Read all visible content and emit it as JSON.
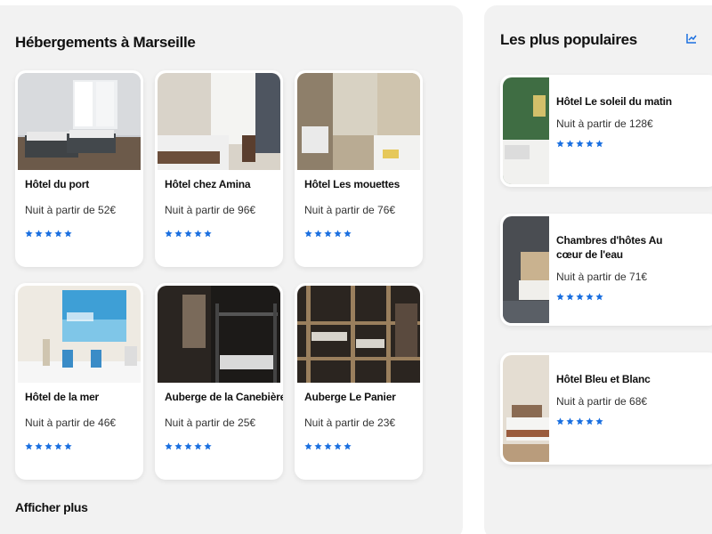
{
  "main": {
    "title": "Hébergements à Marseille",
    "show_more": "Afficher plus",
    "hotels": [
      {
        "name": "Hôtel du port",
        "price": "Nuit à partir de 52€",
        "rating": 5
      },
      {
        "name": "Hôtel chez Amina",
        "price": "Nuit à partir de 96€",
        "rating": 5
      },
      {
        "name": "Hôtel Les mouettes",
        "price": "Nuit à partir de 76€",
        "rating": 5
      },
      {
        "name": "Hôtel de la mer",
        "price": "Nuit à partir de 46€",
        "rating": 5
      },
      {
        "name": "Auberge de la Canebière",
        "price": "Nuit à partir de 25€",
        "rating": 5
      },
      {
        "name": "Auberge Le Panier",
        "price": "Nuit à partir de 23€",
        "rating": 5
      }
    ]
  },
  "sidebar": {
    "title": "Les plus populaires",
    "icon": "chart-icon",
    "items": [
      {
        "name": "Hôtel Le soleil du matin",
        "price": "Nuit à partir de 128€",
        "rating": 5
      },
      {
        "name": "Chambres d'hôtes Au cœur de l'eau",
        "price": "Nuit à partir de 71€",
        "rating": 5
      },
      {
        "name": "Hôtel Bleu et Blanc",
        "price": "Nuit à partir de 68€",
        "rating": 5
      }
    ]
  },
  "colors": {
    "accent": "#1a6fe0",
    "panel": "#f2f2f2"
  }
}
